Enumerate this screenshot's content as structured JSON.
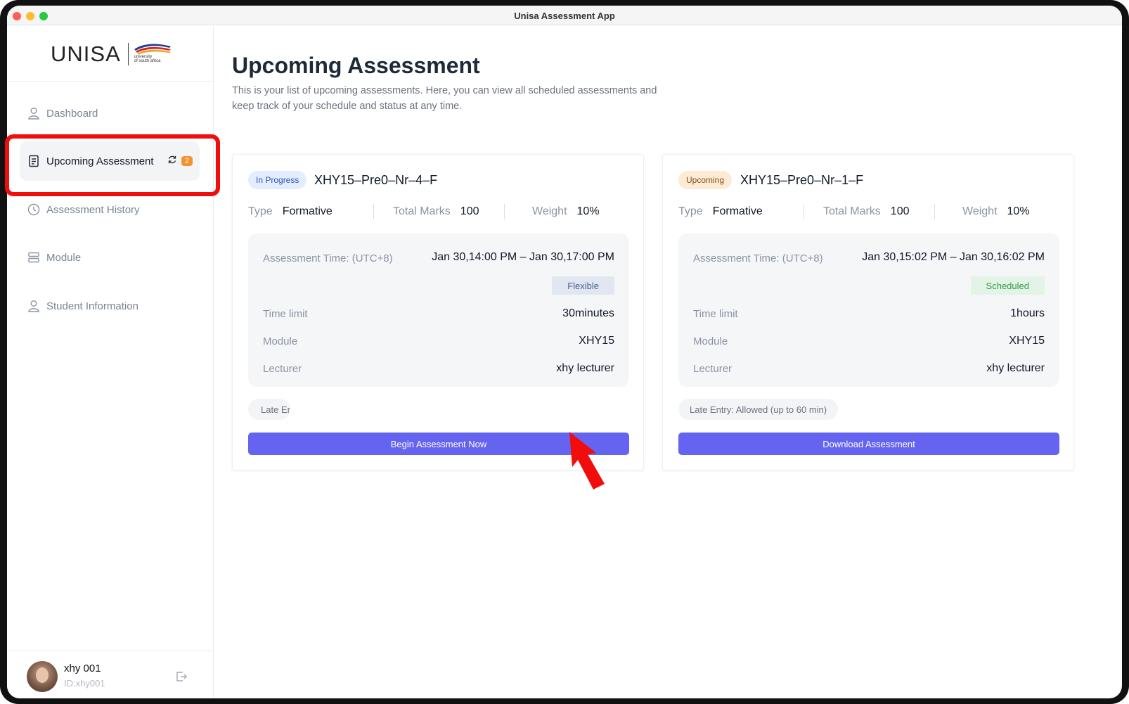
{
  "window": {
    "title": "Unisa Assessment App"
  },
  "logo": {
    "text": "UNISA",
    "subtext_1": "university",
    "subtext_2": "of south africa"
  },
  "sidebar": {
    "items": [
      {
        "label": "Dashboard",
        "icon": "user-icon"
      },
      {
        "label": "Upcoming Assessment",
        "icon": "document-icon",
        "badge": "2",
        "badge_icon": "refresh-icon"
      },
      {
        "label": "Assessment History",
        "icon": "clock-icon"
      },
      {
        "label": "Module",
        "icon": "stack-icon"
      },
      {
        "label": "Student Information",
        "icon": "user-icon"
      }
    ]
  },
  "user": {
    "name": "xhy 001",
    "id": "ID:xhy001"
  },
  "page": {
    "title": "Upcoming Assessment",
    "description": "This is your list of upcoming assessments. Here, you can view all scheduled assessments and keep track of your schedule and status at any time."
  },
  "cards": [
    {
      "status": "In Progress",
      "code": "XHY15–Pre0–Nr–4–F",
      "type_label": "Type",
      "type_value": "Formative",
      "marks_label": "Total Marks",
      "marks_value": "100",
      "weight_label": "Weight",
      "weight_value": "10%",
      "time_label": "Assessment Time: (UTC+8)",
      "time_value": "Jan 30,14:00 PM – Jan 30,17:00 PM",
      "mode": "Flexible",
      "limit_label": "Time limit",
      "limit_value": "30minutes",
      "module_label": "Module",
      "module_value": "XHY15",
      "lecturer_label": "Lecturer",
      "lecturer_value": "xhy lecturer",
      "late_entry": "Late Er",
      "action": "Begin Assessment Now"
    },
    {
      "status": "Upcoming",
      "code": "XHY15–Pre0–Nr–1–F",
      "type_label": "Type",
      "type_value": "Formative",
      "marks_label": "Total Marks",
      "marks_value": "100",
      "weight_label": "Weight",
      "weight_value": "10%",
      "time_label": "Assessment Time: (UTC+8)",
      "time_value": "Jan 30,15:02 PM – Jan 30,16:02 PM",
      "mode": "Scheduled",
      "limit_label": "Time limit",
      "limit_value": "1hours",
      "module_label": "Module",
      "module_value": "XHY15",
      "lecturer_label": "Lecturer",
      "lecturer_value": "xhy lecturer",
      "late_entry": "Late Entry: Allowed (up to 60 min)",
      "action": "Download Assessment"
    }
  ],
  "colors": {
    "accent": "#6464f0",
    "highlight": "#f20d0d",
    "badge": "#f5922f",
    "scheduled": "#2e9a47"
  }
}
